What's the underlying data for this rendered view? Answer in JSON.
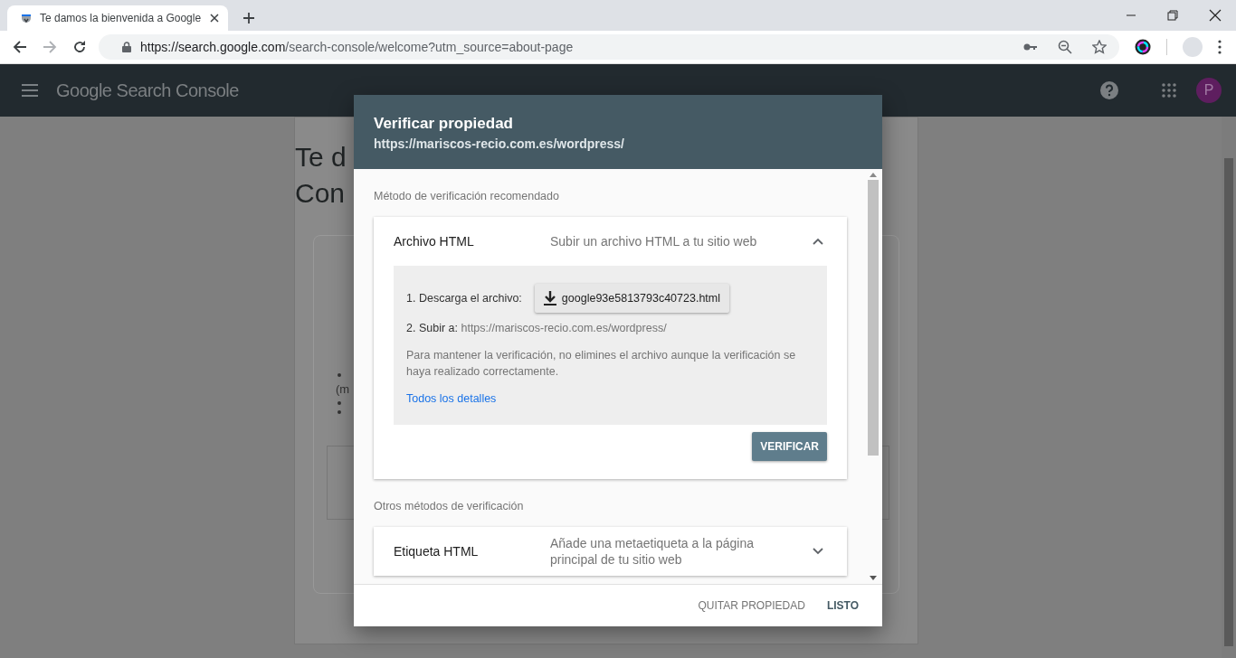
{
  "browser": {
    "tab": {
      "title": "Te damos la bienvenida a Google"
    },
    "url": {
      "host": "https://search.google.com",
      "path": "/search-console/welcome?utm_source=about-page"
    }
  },
  "app_bar": {
    "title": "Google Search Console",
    "avatar": "P"
  },
  "background": {
    "heading_lines": [
      "Te d",
      "Con"
    ],
    "list_fragment": "(m"
  },
  "dialog": {
    "title": "Verificar propiedad",
    "subtitle": "https://mariscos-recio.com.es/wordpress/",
    "sections": [
      {
        "label": "Método de verificación recomendado",
        "methods": [
          {
            "name": "Archivo HTML",
            "description": "Subir un archivo HTML a tu sitio web",
            "expanded": true,
            "details": {
              "step1": "1. Descarga el archivo:",
              "file_button": "google93e5813793c40723.html",
              "step2_label": "2. Subir a:",
              "step2_url": "https://mariscos-recio.com.es/wordpress/",
              "note": "Para mantener la verificación, no elimines el archivo aunque la verificación se haya realizado correctamente.",
              "link": "Todos los detalles",
              "action": "VERIFICAR"
            }
          }
        ]
      },
      {
        "label": "Otros métodos de verificación",
        "methods": [
          {
            "name": "Etiqueta HTML",
            "description": "Añade una metaetiqueta a la página principal de tu sitio web",
            "expanded": false
          }
        ]
      }
    ],
    "footer_buttons": [
      "QUITAR PROPIEDAD",
      "LISTO"
    ]
  }
}
